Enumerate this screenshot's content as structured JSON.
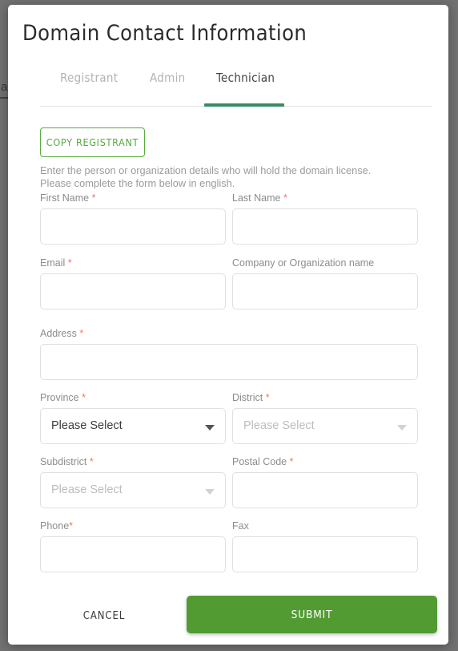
{
  "background": {
    "fragment_text": "a",
    "accent_color": "#2f6b4f"
  },
  "modal": {
    "title": "Domain Contact Information",
    "tabs": [
      {
        "label": "Registrant",
        "active": false
      },
      {
        "label": "Admin",
        "active": false
      },
      {
        "label": "Technician",
        "active": true
      }
    ],
    "active_tab_color": "#3a8a66",
    "copy_button": {
      "label": "COPY REGISTRANT",
      "border_color": "#5aab3d",
      "text_color": "#57a83c"
    },
    "intro_line1": "Enter the person or organization details who will hold the domain license.",
    "intro_line2": "Please complete the form below in english.",
    "required_marker": "*",
    "required_color": "#f4736a",
    "fields": [
      {
        "name": "first_name",
        "label": "First Name",
        "required": true,
        "required_spaced": true,
        "type": "text",
        "value": "",
        "placeholder": ""
      },
      {
        "name": "last_name",
        "label": "Last Name",
        "required": true,
        "required_spaced": true,
        "type": "text",
        "value": "",
        "placeholder": ""
      },
      {
        "name": "email",
        "label": "Email",
        "required": true,
        "required_spaced": true,
        "type": "text",
        "value": "",
        "placeholder": ""
      },
      {
        "name": "company",
        "label": "Company or Organization name",
        "required": false,
        "required_spaced": false,
        "type": "text",
        "value": "",
        "placeholder": ""
      },
      {
        "name": "address",
        "label": "Address",
        "required": true,
        "required_spaced": true,
        "type": "text",
        "value": "",
        "placeholder": ""
      },
      {
        "name": "province",
        "label": "Province",
        "required": true,
        "required_spaced": true,
        "type": "select",
        "value": "Please Select",
        "disabled": false
      },
      {
        "name": "district",
        "label": "District",
        "required": true,
        "required_spaced": true,
        "type": "select",
        "value": "Please Select",
        "disabled": true
      },
      {
        "name": "subdistrict",
        "label": "Subdistrict",
        "required": true,
        "required_spaced": true,
        "type": "select",
        "value": "Please Select",
        "disabled": true
      },
      {
        "name": "postal_code",
        "label": "Postal Code",
        "required": true,
        "required_spaced": true,
        "type": "text",
        "value": "",
        "placeholder": ""
      },
      {
        "name": "phone",
        "label": "Phone",
        "required": true,
        "required_spaced": false,
        "type": "text",
        "value": "",
        "placeholder": ""
      },
      {
        "name": "fax",
        "label": "Fax",
        "required": false,
        "required_spaced": false,
        "type": "text",
        "value": "",
        "placeholder": ""
      }
    ],
    "footer": {
      "cancel_label": "CANCEL",
      "submit_label": "SUBMIT",
      "submit_color": "#529b33"
    }
  }
}
